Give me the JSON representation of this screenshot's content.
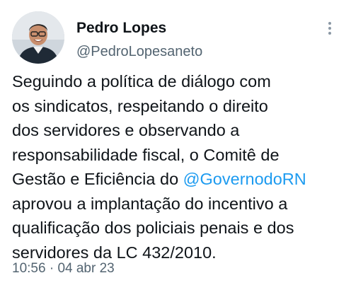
{
  "author": {
    "display_name": "Pedro Lopes",
    "handle": "@PedroLopesaneto"
  },
  "tweet": {
    "line1": "Seguindo a política de diálogo com",
    "line2": "os sindicatos, respeitando o direito",
    "line3": "dos servidores e observando a",
    "line4": "responsabilidade fiscal, o Comitê de",
    "line5_before": "Gestão e Eficiência do ",
    "mention": "@GovernodoRN",
    "line6": "aprovou a implantação do incentivo a",
    "line7": "qualificação dos policiais penais e dos",
    "line8": "servidores da LC 432/2010."
  },
  "meta": {
    "time": "10:56",
    "separator": " · ",
    "date": "04 abr 23"
  },
  "icons": {
    "more": "more-vertical-icon",
    "avatar": "profile-photo"
  },
  "colors": {
    "text": "#0f1419",
    "secondary": "#536471",
    "link": "#1d9bf0"
  }
}
